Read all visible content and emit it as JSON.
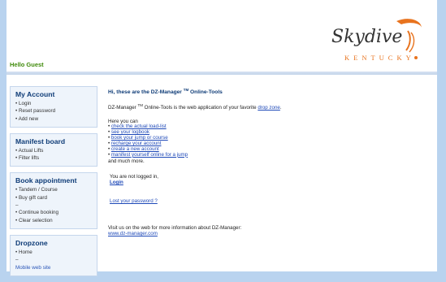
{
  "header": {
    "greeting": "Hello Guest",
    "logo_main": "Skydive",
    "logo_sub": "KENTUCKY",
    "logo_mark": "®"
  },
  "sidebar": {
    "sections": [
      {
        "title": "My Account",
        "items": [
          "• Login",
          "• Reset password",
          "• Add new"
        ]
      },
      {
        "title": "Manifest board",
        "items": [
          "• Actual Lifts",
          "• Filter lifts"
        ]
      },
      {
        "title": "Book appointment",
        "items": [
          "• Tandem / Course",
          "• Buy gift card",
          "–",
          "• Continue booking",
          "• Clear selection"
        ]
      },
      {
        "title": "Dropzone",
        "items": [
          "• Home",
          "–",
          "Mobile web site"
        ]
      }
    ]
  },
  "main": {
    "title_pre": "Hi, these are the DZ-Manager ",
    "title_tm": "TM",
    "title_post": " Online-Tools",
    "intro_pre": "DZ-Manager ",
    "intro_tm": "TM",
    "intro_post": " Online-Tools is the web application of your favorite ",
    "intro_link": "drop zone",
    "intro_end": ".",
    "here_you_can": "Here you can",
    "features": [
      "check the actual load-list",
      "see your logbook",
      "book your jump or course",
      "recharge your account",
      "create a new account",
      "manifest yourself online for a jump"
    ],
    "and_more": "and much more.",
    "not_logged_in": "You are not logged in,",
    "login_link": "Login",
    "lost_password": "Lost your password ?",
    "visit_text": "Visit us on the web for more information about DZ-Manager:",
    "visit_link": "www.dz-manager.com"
  },
  "colors": {
    "background": "#b9d3ef",
    "greeting": "#3f8a0a",
    "heading": "#0f3c77",
    "link": "#1e49b8",
    "logo_orange": "#e8731e"
  }
}
